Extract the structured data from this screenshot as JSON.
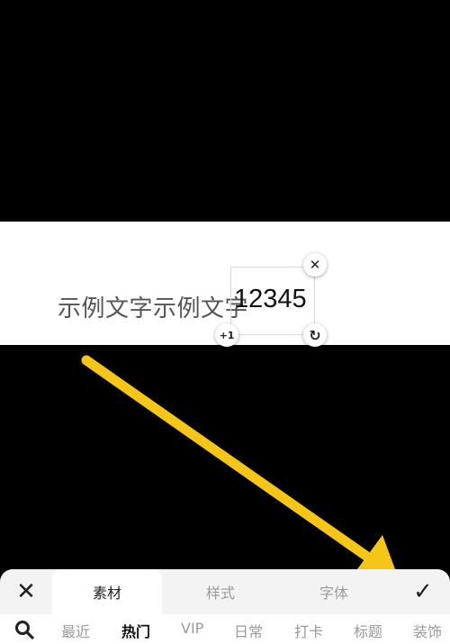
{
  "canvas": {
    "sample_text": "示例文字示例文字",
    "sticker_text": "12345",
    "handles": {
      "close_glyph": "✕",
      "plus_label": "+1",
      "rotate_glyph": "↻"
    },
    "annotation_arrow_color": "#F5C518"
  },
  "panel": {
    "close_glyph": "✕",
    "confirm_glyph": "✓",
    "tabs": [
      {
        "label": "素材",
        "active": true
      },
      {
        "label": "样式",
        "active": false
      },
      {
        "label": "字体",
        "active": false
      }
    ],
    "categories": [
      {
        "label": "最近",
        "active": false
      },
      {
        "label": "热门",
        "active": true
      },
      {
        "label": "VIP",
        "active": false
      },
      {
        "label": "日常",
        "active": false
      },
      {
        "label": "打卡",
        "active": false
      },
      {
        "label": "标题",
        "active": false
      },
      {
        "label": "装饰",
        "active": false
      }
    ]
  }
}
